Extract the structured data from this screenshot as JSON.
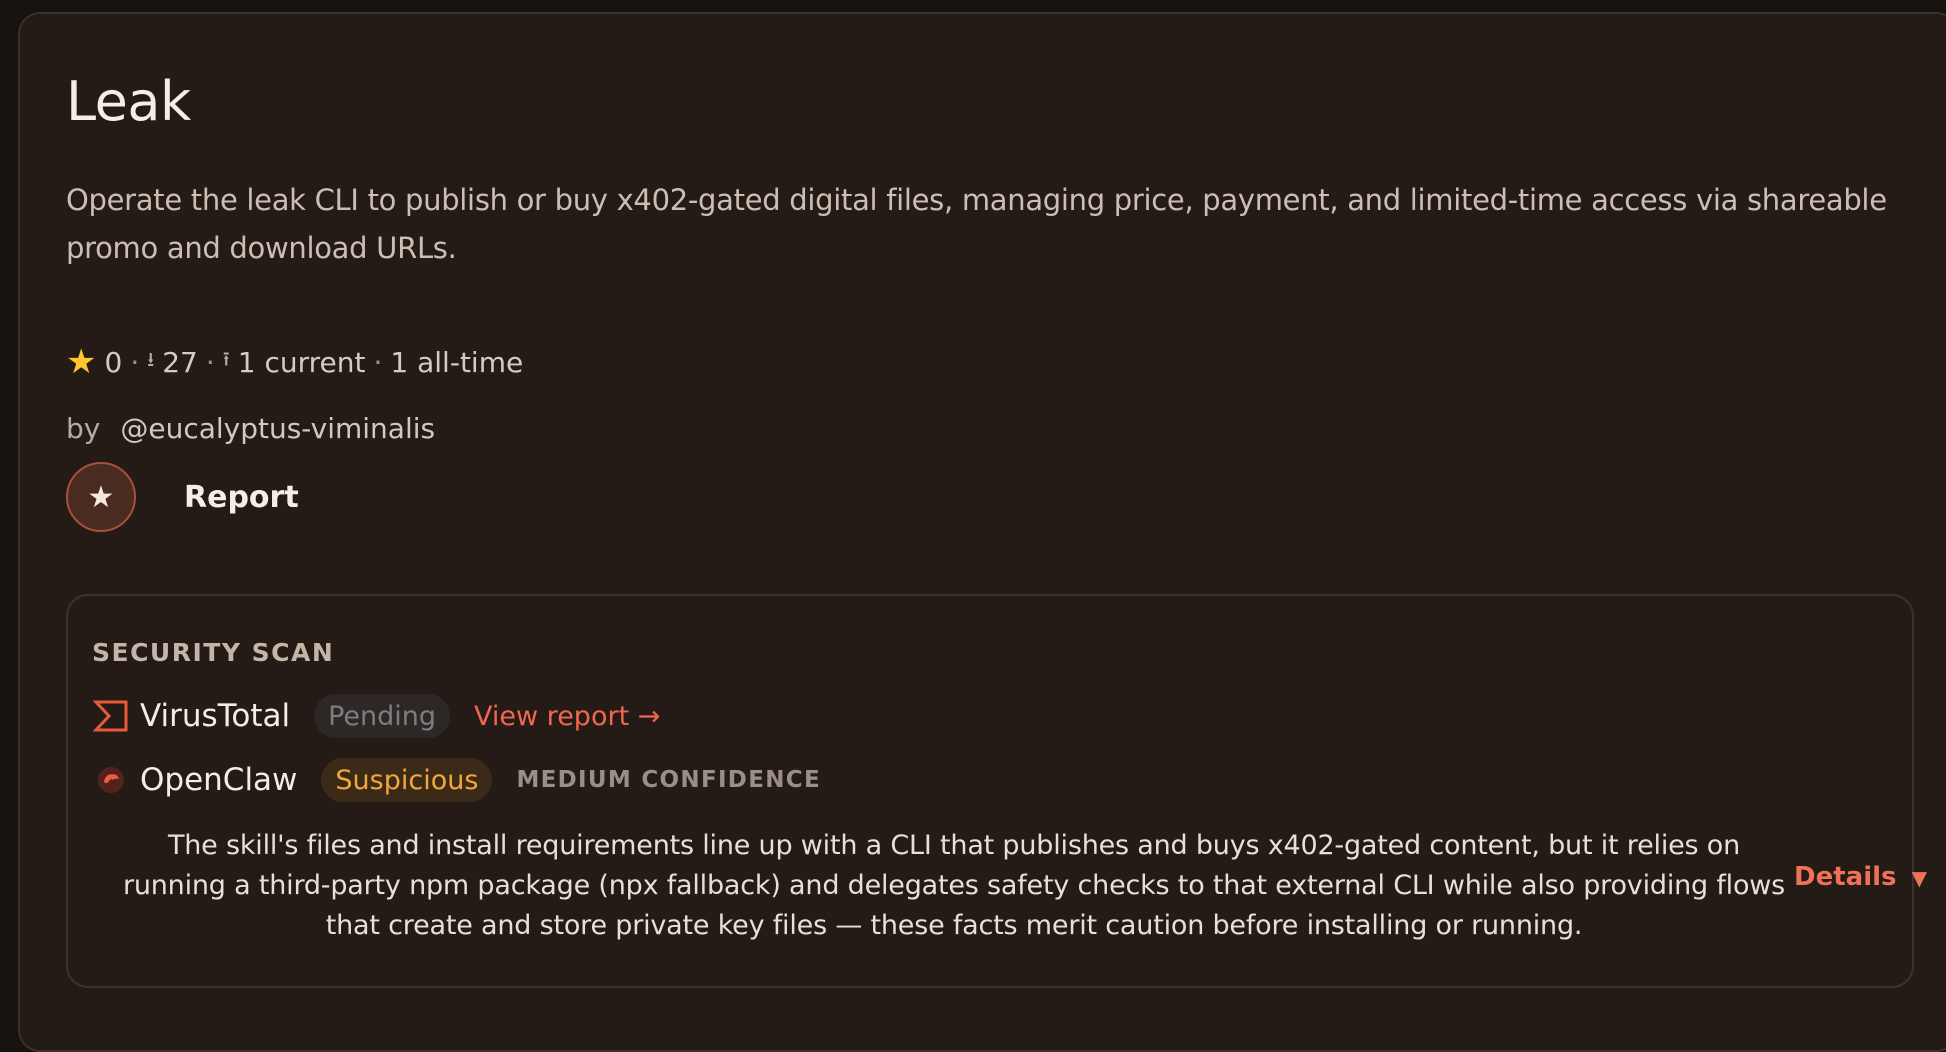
{
  "skill": {
    "title": "Leak",
    "description": "Operate the leak CLI to publish or buy x402-gated digital files, managing price, payment, and limited-time access via shareable promo and download URLs.",
    "stats": {
      "stars": "0",
      "downloads": "27",
      "installs_current": "1 current",
      "installs_all_time": "1 all-time",
      "star_icon": "star-icon",
      "download_icon": "download-icon",
      "install_icon": "install-icon"
    },
    "byline": {
      "prefix": "by",
      "author": "@eucalyptus-viminalis"
    },
    "actions": {
      "star_icon": "★",
      "report_label": "Report"
    }
  },
  "security_scan": {
    "title": "SECURITY SCAN",
    "virustotal": {
      "name": "VirusTotal",
      "status": "Pending",
      "link_label": "View report →",
      "icon": "virustotal-icon"
    },
    "openclaw": {
      "name": "OpenClaw",
      "status": "Suspicious",
      "confidence": "MEDIUM CONFIDENCE",
      "icon": "openclaw-icon",
      "summary": "The skill's files and install requirements line up with a CLI that publishes and buys x402-gated content, but it relies on running a third-party npm package (npx fallback) and delegates safety checks to that external CLI while also providing flows that create and store private key files — these facts merit caution before installing or running.",
      "details_label": "Details"
    }
  },
  "colors": {
    "background": "#241b16",
    "accent": "#f0674f",
    "warning": "#f2a63b",
    "muted": "#9a8f86"
  }
}
